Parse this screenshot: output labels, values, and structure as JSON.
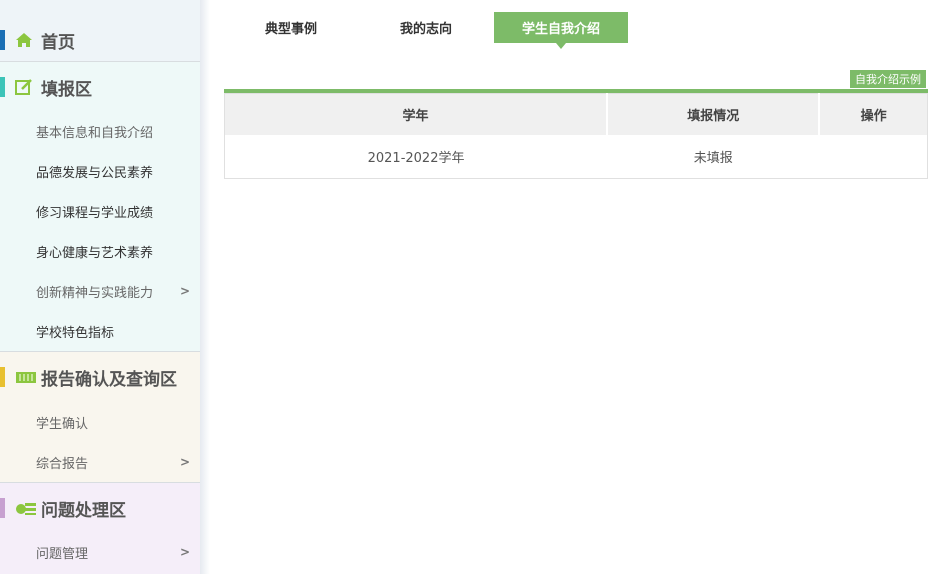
{
  "sidebar": {
    "home": {
      "label": "首页",
      "color": "#1a6fb5"
    },
    "fill": {
      "label": "填报区",
      "color": "#3cc4b8",
      "items": [
        {
          "label": "基本信息和自我介绍"
        },
        {
          "label": "品德发展与公民素养"
        },
        {
          "label": "修习课程与学业成绩"
        },
        {
          "label": "身心健康与艺术素养"
        },
        {
          "label": "创新精神与实践能力",
          "chevron": ">"
        },
        {
          "label": "学校特色指标"
        }
      ]
    },
    "report": {
      "label": "报告确认及查询区",
      "color": "#e8c030",
      "items": [
        {
          "label": "学生确认"
        },
        {
          "label": "综合报告",
          "chevron": ">"
        }
      ]
    },
    "issue": {
      "label": "问题处理区",
      "color": "#c7a0d0",
      "items": [
        {
          "label": "问题管理",
          "chevron": ">"
        }
      ]
    }
  },
  "tabs": [
    {
      "label": "典型事例"
    },
    {
      "label": "我的志向"
    },
    {
      "label": "学生自我介绍",
      "active": true
    }
  ],
  "example_button": "自我介绍示例",
  "table": {
    "headers": [
      "学年",
      "填报情况",
      "操作"
    ],
    "rows": [
      [
        "2021-2022学年",
        "未填报",
        ""
      ]
    ]
  },
  "accent": "#7dbb68"
}
